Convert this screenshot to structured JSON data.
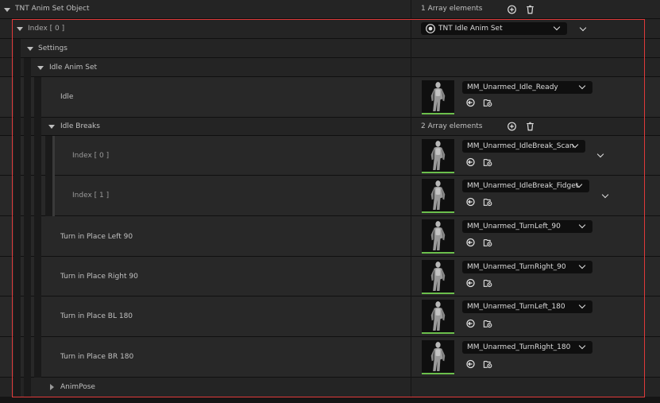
{
  "root": {
    "label": "TNT Anim Set Object",
    "count": "1 Array elements"
  },
  "index0": {
    "label": "Index [ 0 ]",
    "class_value": "TNT Idle Anim Set"
  },
  "settings": {
    "label": "Settings"
  },
  "idle_anim_set": {
    "label": "Idle Anim Set"
  },
  "idle": {
    "label": "Idle",
    "asset": "MM_Unarmed_Idle_Ready"
  },
  "idle_breaks": {
    "label": "Idle Breaks",
    "count": "2 Array elements",
    "items": [
      {
        "label": "Index [ 0 ]",
        "asset": "MM_Unarmed_IdleBreak_Scan"
      },
      {
        "label": "Index [ 1 ]",
        "asset": "MM_Unarmed_IdleBreak_Fidget"
      }
    ]
  },
  "turns": [
    {
      "label": "Turn in Place Left 90",
      "asset": "MM_Unarmed_TurnLeft_90"
    },
    {
      "label": "Turn in Place Right 90",
      "asset": "MM_Unarmed_TurnRight_90"
    },
    {
      "label": "Turn in Place BL 180",
      "asset": "MM_Unarmed_TurnLeft_180"
    },
    {
      "label": "Turn in Place BR 180",
      "asset": "MM_Unarmed_TurnRight_180"
    }
  ],
  "anim_pose": {
    "label": "AnimPose"
  },
  "colors": {
    "highlight": "#e03a3a",
    "thumbnail_underline": "#6bbf4c"
  },
  "icons": [
    "add-element-icon",
    "delete-all-icon",
    "use-selected-icon",
    "browse-asset-icon",
    "blueprint-class-icon",
    "chevron-down-icon"
  ]
}
